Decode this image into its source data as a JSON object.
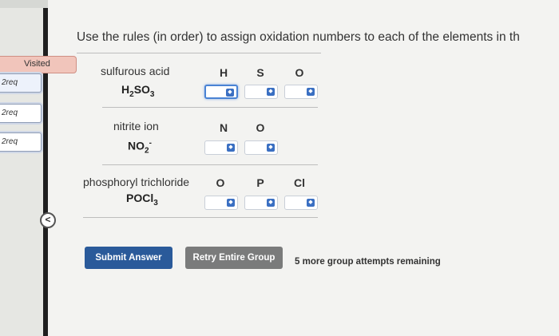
{
  "sidebar": {
    "visited_label": "Visited",
    "items": [
      {
        "label": "2req"
      },
      {
        "label": "2req"
      },
      {
        "label": "2req"
      }
    ],
    "back_glyph": "<"
  },
  "instruction": "Use the rules (in order) to assign oxidation numbers to each of the elements in th",
  "compounds": [
    {
      "name": "sulfurous acid",
      "formula_main": "H",
      "formula_sub1": "2",
      "formula_mid": "SO",
      "formula_sub2": "3",
      "elements": [
        "H",
        "S",
        "O"
      ]
    },
    {
      "name": "nitrite ion",
      "formula_main": "NO",
      "formula_sub1": "2",
      "formula_sup": "-",
      "elements": [
        "N",
        "O"
      ]
    },
    {
      "name": "phosphoryl trichloride",
      "formula_main": "POCl",
      "formula_sub1": "3",
      "elements": [
        "O",
        "P",
        "Cl"
      ]
    }
  ],
  "select_icon": "chevron-up-down-icon",
  "buttons": {
    "submit": "Submit Answer",
    "retry": "Retry Entire Group"
  },
  "attempts_text": "5 more group attempts remaining",
  "colors": {
    "accent": "#2a5a9a",
    "retry": "#7a7b7b",
    "visited": "#f1c5bb"
  }
}
